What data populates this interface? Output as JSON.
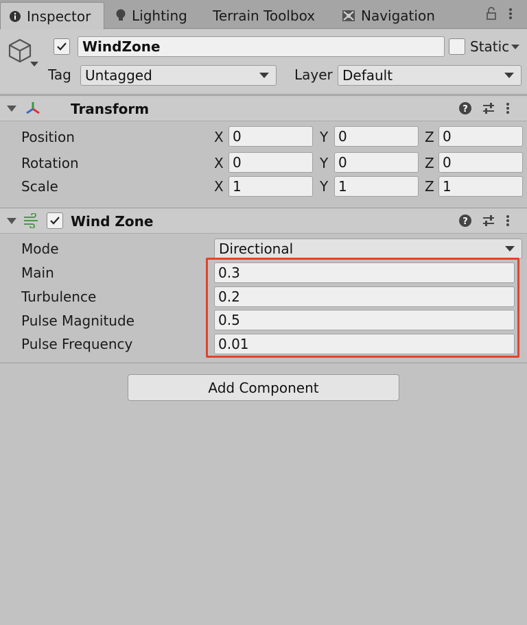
{
  "tabs": [
    {
      "label": "Inspector",
      "icon": "info-icon",
      "active": true
    },
    {
      "label": "Lighting",
      "icon": "bulb-icon",
      "active": false
    },
    {
      "label": "Terrain Toolbox",
      "icon": "",
      "active": false
    },
    {
      "label": "Navigation",
      "icon": "navigation-icon",
      "active": false
    }
  ],
  "header": {
    "object_name": "WindZone",
    "active_checked": true,
    "static_label": "Static",
    "static_checked": false,
    "tag_label": "Tag",
    "tag_value": "Untagged",
    "layer_label": "Layer",
    "layer_value": "Default"
  },
  "transform": {
    "title": "Transform",
    "rows": [
      {
        "label": "Position",
        "x": "0",
        "y": "0",
        "z": "0"
      },
      {
        "label": "Rotation",
        "x": "0",
        "y": "0",
        "z": "0"
      },
      {
        "label": "Scale",
        "x": "1",
        "y": "1",
        "z": "1"
      }
    ],
    "axis": {
      "x": "X",
      "y": "Y",
      "z": "Z"
    }
  },
  "windzone": {
    "title": "Wind Zone",
    "enabled": true,
    "mode_label": "Mode",
    "mode_value": "Directional",
    "fields": [
      {
        "label": "Main",
        "value": "0.3"
      },
      {
        "label": "Turbulence",
        "value": "0.2"
      },
      {
        "label": "Pulse Magnitude",
        "value": "0.5"
      },
      {
        "label": "Pulse Frequency",
        "value": "0.01"
      }
    ]
  },
  "add_component_label": "Add Component",
  "colors": {
    "highlight": "#e0432d"
  }
}
